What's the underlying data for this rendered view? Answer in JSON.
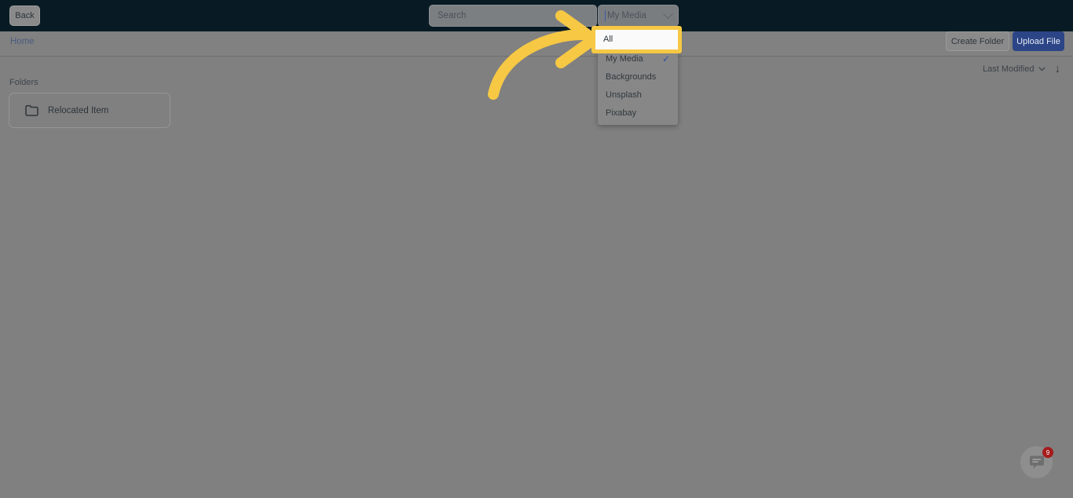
{
  "topbar": {
    "back_label": "Back",
    "search_placeholder": "Search",
    "search_value": "",
    "media_filter_label": "My Media",
    "chevron_icon": "chevron-down-icon"
  },
  "dropdown": {
    "items": [
      {
        "label": "All",
        "selected": false
      },
      {
        "label": "My Media",
        "selected": true
      },
      {
        "label": "Backgrounds",
        "selected": false
      },
      {
        "label": "Unsplash",
        "selected": false
      },
      {
        "label": "Pixabay",
        "selected": false
      }
    ],
    "check_glyph": "✓"
  },
  "breadcrumb": {
    "home_label": "Home"
  },
  "actions": {
    "create_folder_label": "Create Folder",
    "upload_file_label": "Upload File"
  },
  "sort": {
    "label": "Last Modified",
    "chevron_icon": "chevron-down-icon",
    "direction_icon": "arrow-down-icon",
    "direction_glyph": "↓"
  },
  "folders": {
    "section_title": "Folders",
    "items": [
      {
        "name": "Relocated Item",
        "icon": "folder-icon"
      }
    ]
  },
  "annotation": {
    "arrow_icon": "curved-arrow-icon",
    "highlight_target": "All",
    "accent_color": "#f6c844"
  },
  "chat": {
    "icon": "chat-bubble-icon",
    "badge_count": "9",
    "badge_color": "#a61b1b"
  },
  "theme": {
    "topbar_bg": "#081b24",
    "body_bg": "#808080",
    "primary_button": "#2c4587",
    "link_color": "#4a5d7e"
  }
}
